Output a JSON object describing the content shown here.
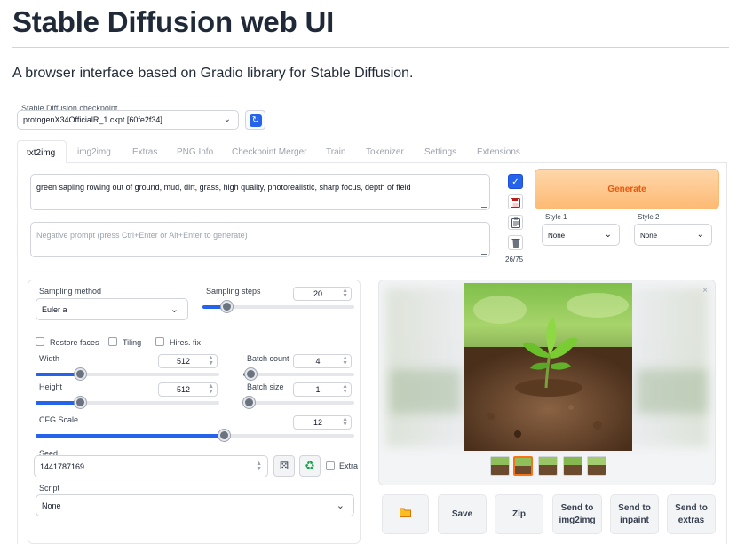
{
  "header": {
    "title": "Stable Diffusion web UI",
    "subtitle": "A browser interface based on Gradio library for Stable Diffusion."
  },
  "checkpoint": {
    "label": "Stable Diffusion checkpoint",
    "value": "protogenX34OfficialR_1.ckpt [60fe2f34]",
    "refresh_icon": "refresh-icon"
  },
  "tabs": [
    "txt2img",
    "img2img",
    "Extras",
    "PNG Info",
    "Checkpoint Merger",
    "Train",
    "Tokenizer",
    "Settings",
    "Extensions"
  ],
  "active_tab": "txt2img",
  "prompt": {
    "value": "green sapling rowing out of ground, mud, dirt, grass, high quality, photorealistic, sharp focus, depth of field",
    "negative_placeholder": "Negative prompt (press Ctrl+Enter or Alt+Enter to generate)",
    "token_count": "26/75"
  },
  "toolbar_icons": [
    "check-icon",
    "save-icon",
    "clipboard-icon",
    "trash-icon"
  ],
  "generate": {
    "label": "Generate",
    "style1_label": "Style 1",
    "style1_value": "None",
    "style2_label": "Style 2",
    "style2_value": "None"
  },
  "settings": {
    "sampling_method_label": "Sampling method",
    "sampling_method_value": "Euler a",
    "sampling_steps_label": "Sampling steps",
    "sampling_steps_value": "20",
    "sampling_steps_fraction": 0.16,
    "restore_faces_label": "Restore faces",
    "tiling_label": "Tiling",
    "hires_fix_label": "Hires. fix",
    "width_label": "Width",
    "width_value": "512",
    "width_fraction": 0.24,
    "height_label": "Height",
    "height_value": "512",
    "height_fraction": 0.24,
    "batch_count_label": "Batch count",
    "batch_count_value": "4",
    "batch_count_fraction": 0.06,
    "batch_size_label": "Batch size",
    "batch_size_value": "1",
    "batch_size_fraction": 0.0,
    "cfg_scale_label": "CFG Scale",
    "cfg_scale_value": "12",
    "cfg_scale_fraction": 0.59,
    "seed_label": "Seed",
    "seed_value": "1441787169",
    "extra_label": "Extra",
    "script_label": "Script",
    "script_value": "None"
  },
  "output": {
    "close_label": "×",
    "thumbnails_count": 5,
    "selected_thumbnail": 1
  },
  "actions": {
    "folder_icon": "folder-icon",
    "save": "Save",
    "zip": "Zip",
    "send_img2img_line1": "Send to",
    "send_img2img_line2": "img2img",
    "send_inpaint_line1": "Send to",
    "send_inpaint_line2": "inpaint",
    "send_extras_line1": "Send to",
    "send_extras_line2": "extras"
  }
}
